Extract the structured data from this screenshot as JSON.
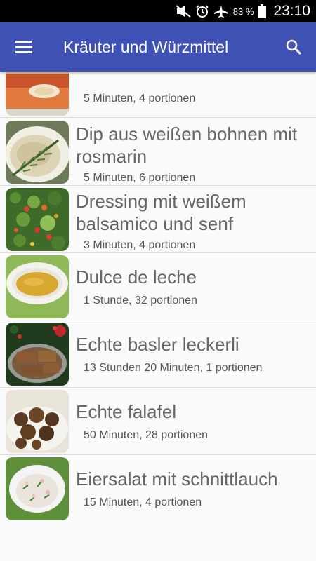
{
  "status": {
    "battery": "83 %",
    "time": "23:10"
  },
  "toolbar": {
    "title": "Kräuter und Würzmittel"
  },
  "recipes": [
    {
      "title": "",
      "meta": "5 Minuten, 4 portionen"
    },
    {
      "title": "Dip aus weißen bohnen mit rosmarin",
      "meta": "5 Minuten, 6 portionen"
    },
    {
      "title": "Dressing mit weißem balsamico und senf",
      "meta": "3 Minuten, 4 portionen"
    },
    {
      "title": "Dulce de leche",
      "meta": "1 Stunde, 32 portionen"
    },
    {
      "title": "Echte basler leckerli",
      "meta": "13 Stunden 20 Minuten, 1 portionen"
    },
    {
      "title": "Echte falafel",
      "meta": "50 Minuten, 28 portionen"
    },
    {
      "title": "Eiersalat mit schnittlauch",
      "meta": "15 Minuten, 4 portionen"
    }
  ]
}
